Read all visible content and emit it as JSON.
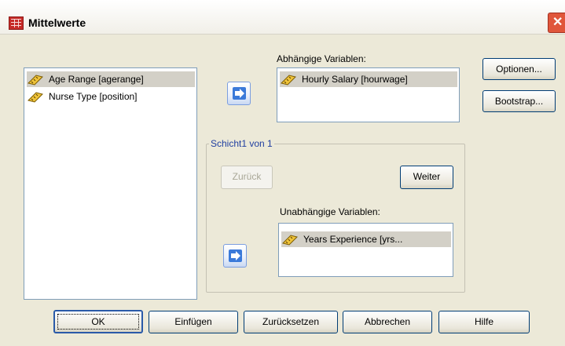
{
  "window": {
    "title": "Mittelwerte",
    "close_glyph": "✕"
  },
  "source_list": {
    "items": [
      {
        "label": "Age Range [agerange]",
        "icon": "scale-ruler-icon",
        "selected": true
      },
      {
        "label": "Nurse Type [position]",
        "icon": "scale-ruler-icon",
        "selected": false
      }
    ]
  },
  "dependent": {
    "label": "Abhängige Variablen:",
    "items": [
      {
        "label": "Hourly Salary [hourwage]",
        "icon": "scale-ruler-icon"
      }
    ]
  },
  "layer": {
    "title": "Schicht1 von 1",
    "previous_label": "Zurück",
    "next_label": "Weiter",
    "independent_label": "Unabhängige Variablen:",
    "items": [
      {
        "label": "Years Experience [yrs...",
        "icon": "scale-ruler-icon"
      }
    ]
  },
  "side_buttons": {
    "options": "Optionen...",
    "bootstrap": "Bootstrap..."
  },
  "footer": {
    "ok": "OK",
    "paste": "Einfügen",
    "reset": "Zurücksetzen",
    "cancel": "Abbrechen",
    "help": "Hilfe"
  },
  "colors": {
    "title_icon": "#c62b28",
    "close": "#e0563b",
    "arrow": "#3b7ad9",
    "dialog_bg": "#ece9d8"
  }
}
